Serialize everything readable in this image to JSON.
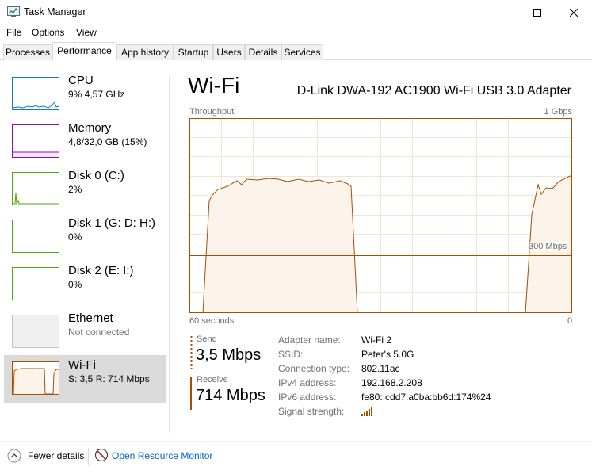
{
  "window": {
    "title": "Task Manager",
    "minimize_glyph": "—",
    "maximize_glyph": "☐",
    "close_glyph": "✕"
  },
  "menu": {
    "file": "File",
    "options": "Options",
    "view": "View"
  },
  "tabs": [
    {
      "label": "Processes"
    },
    {
      "label": "Performance"
    },
    {
      "label": "App history"
    },
    {
      "label": "Startup"
    },
    {
      "label": "Users"
    },
    {
      "label": "Details"
    },
    {
      "label": "Services"
    }
  ],
  "active_tab": "Performance",
  "resources": [
    {
      "name": "CPU",
      "sub": "9% 4,57 GHz",
      "color": "#117dbb"
    },
    {
      "name": "Memory",
      "sub": "4,8/32,0 GB (15%)",
      "color": "#8b12ae"
    },
    {
      "name": "Disk 0 (C:)",
      "sub": "2%",
      "color": "#4da60c"
    },
    {
      "name": "Disk 1 (G: D: H:)",
      "sub": "0%",
      "color": "#4da60c"
    },
    {
      "name": "Disk 2 (E: I:)",
      "sub": "0%",
      "color": "#4da60c"
    },
    {
      "name": "Ethernet",
      "sub": "Not connected",
      "color": "#c0c0c0"
    },
    {
      "name": "Wi-Fi",
      "sub": "S: 3,5 R: 714 Mbps",
      "color": "#a74f01"
    }
  ],
  "selected_resource": "Wi-Fi",
  "detail": {
    "title": "Wi-Fi",
    "adapter": "D-Link DWA-192 AC1900 Wi-Fi USB 3.0 Adapter",
    "throughput_label": "Throughput",
    "max_label": "1 Gbps",
    "scale_label": "300 Mbps",
    "time_left": "60 seconds",
    "time_right": "0",
    "accent_color": "#a74f01",
    "fill_color": "#fcf3eb",
    "grid_color": "#f4e3d3"
  },
  "send": {
    "label": "Send",
    "value": "3,5 Mbps"
  },
  "receive": {
    "label": "Receive",
    "value": "714 Mbps"
  },
  "properties": [
    {
      "key": "Adapter name:",
      "value": "Wi-Fi 2"
    },
    {
      "key": "SSID:",
      "value": "Peter's 5.0G"
    },
    {
      "key": "Connection type:",
      "value": "802.11ac"
    },
    {
      "key": "IPv4 address:",
      "value": "192.168.2.208"
    },
    {
      "key": "IPv6 address:",
      "value": "fe80::cdd7:a0ba:bb6d:174%24"
    },
    {
      "key": "Signal strength:",
      "value": ""
    }
  ],
  "footer": {
    "fewer_details": "Fewer details",
    "resource_monitor": "Open Resource Monitor",
    "link_color": "#0066cc"
  }
}
